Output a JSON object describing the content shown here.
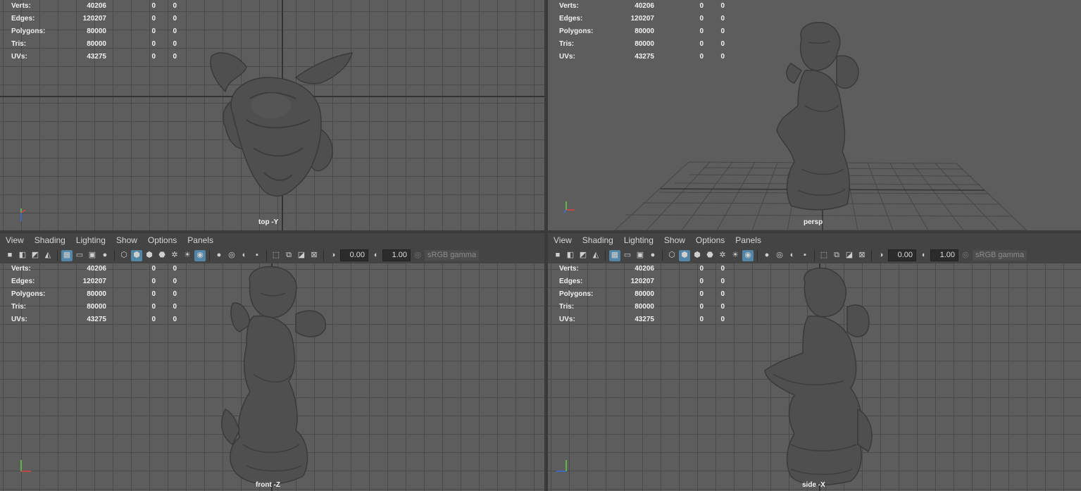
{
  "menu": [
    "View",
    "Shading",
    "Lighting",
    "Show",
    "Options",
    "Panels"
  ],
  "toolbar": {
    "exposure": "0.00",
    "gamma_value": "1.00",
    "color_space": "sRGB gamma"
  },
  "hud": {
    "rows": [
      {
        "label": "Verts:",
        "a": "40206",
        "b": "0",
        "c": "0"
      },
      {
        "label": "Edges:",
        "a": "120207",
        "b": "0",
        "c": "0"
      },
      {
        "label": "Polygons:",
        "a": "80000",
        "b": "0",
        "c": "0"
      },
      {
        "label": "Tris:",
        "a": "80000",
        "b": "0",
        "c": "0"
      },
      {
        "label": "UVs:",
        "a": "43275",
        "b": "0",
        "c": "0"
      }
    ]
  },
  "viewports": {
    "top": "top -Y",
    "persp": "persp",
    "front": "front -Z",
    "side": "side -X"
  },
  "icons": [
    "camera-icon",
    "camera-attr-icon",
    "bookmark-icon",
    "image-plane-icon",
    "grid-icon",
    "film-gate-icon",
    "resolution-gate-icon",
    "gate-mask-icon",
    "wireframe-icon",
    "smooth-shade-icon",
    "wireframe-on-shaded-icon",
    "textured-icon",
    "use-lights-icon",
    "shadows-icon",
    "isolate-select-icon",
    "xray-icon",
    "xray-joints-icon",
    "backface-icon",
    "ssao-icon",
    "select-icon",
    "two-side-icon",
    "motion-blur-icon",
    "aa-icon",
    "exposure-icon",
    "gamma-icon"
  ],
  "colors": {
    "viewport_bg": "#5d5d5d",
    "grid": "#4a4a4a",
    "panel": "#444444",
    "highlight": "#5285a6",
    "model": "#4e4e4e"
  }
}
